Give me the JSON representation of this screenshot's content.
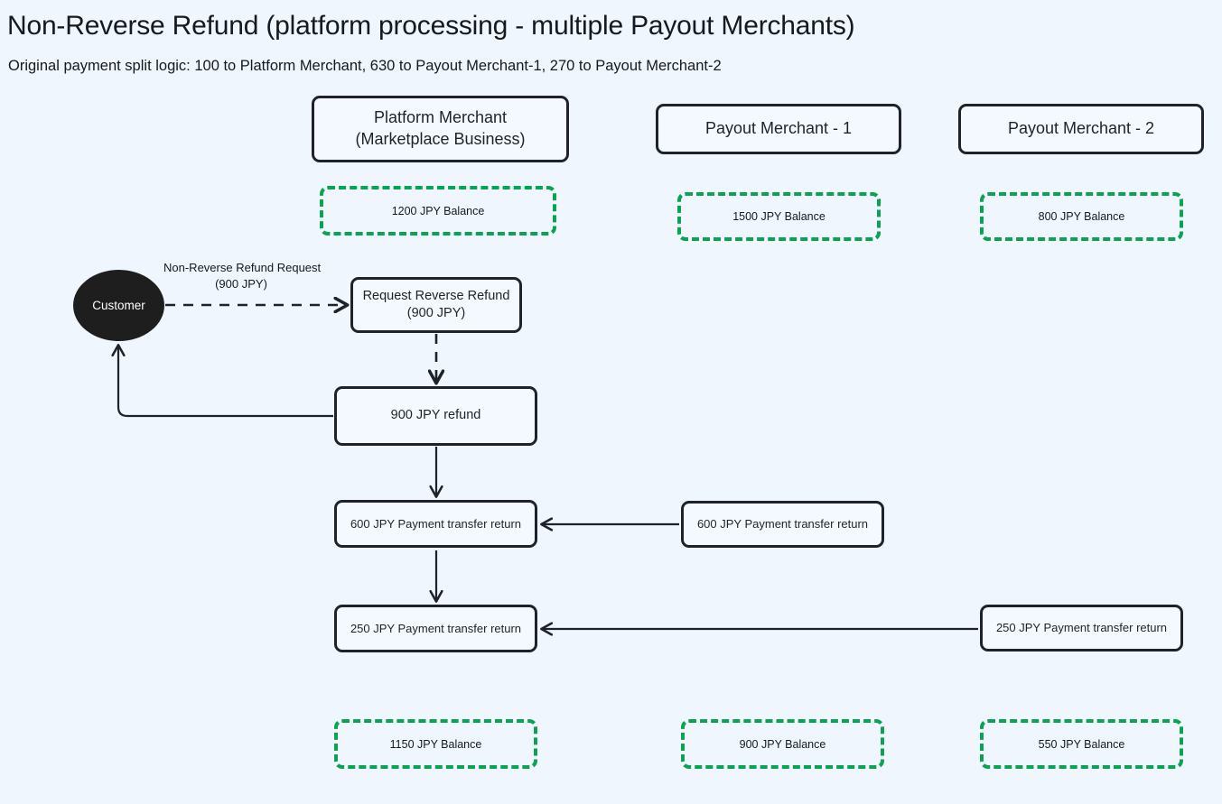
{
  "header": {
    "title": "Non-Reverse Refund (platform processing - multiple Payout Merchants)",
    "subtitle": "Original payment split logic: 100 to Platform Merchant, 630 to Payout Merchant-1, 270 to Payout Merchant-2"
  },
  "colors": {
    "background": "#eff6fe",
    "node_border": "#1f2329",
    "node_fill": "#f4f9ff",
    "balance_border": "#0aa351",
    "actor_fill": "#1e1e1e",
    "text": "#16191d"
  },
  "columns": [
    {
      "key": "platform",
      "title": "Platform Merchant\n(Marketplace Business)"
    },
    {
      "key": "payout1",
      "title": "Payout Merchant - 1"
    },
    {
      "key": "payout2",
      "title": "Payout Merchant - 2"
    }
  ],
  "nodes": {
    "platform_merchant_line1": "Platform Merchant",
    "platform_merchant_line2": "(Marketplace Business)",
    "payout_merchant_1": "Payout Merchant - 1",
    "payout_merchant_2": "Payout Merchant - 2",
    "customer": "Customer",
    "request_reverse_refund_line1": "Request Reverse Refund",
    "request_reverse_refund_line2": "(900 JPY)",
    "refund_900": "900 JPY refund",
    "platform_transfer_return_600": "600 JPY Payment transfer return",
    "payout1_transfer_return_600": "600 JPY Payment transfer return",
    "platform_transfer_return_250": "250 JPY Payment transfer return",
    "payout2_transfer_return_250": "250 JPY Payment transfer return"
  },
  "balances_before": {
    "platform": "1200 JPY Balance",
    "payout1": "1500 JPY Balance",
    "payout2": "800 JPY Balance"
  },
  "balances_after": {
    "platform": "1150 JPY Balance",
    "payout1": "900 JPY Balance",
    "payout2": "550 JPY Balance"
  },
  "edge_labels": {
    "refund_request_line1": "Non-Reverse Refund Request",
    "refund_request_line2": "(900 JPY)"
  }
}
